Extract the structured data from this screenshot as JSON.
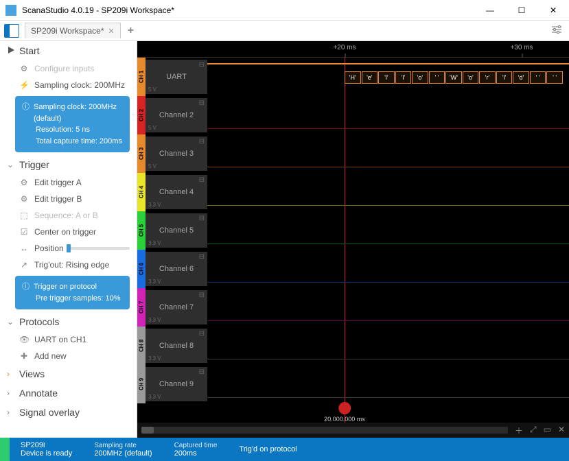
{
  "title": "ScanaStudio 4.0.19 - SP209i Workspace*",
  "tab": {
    "label": "SP209i Workspace*"
  },
  "sidebar": {
    "start": {
      "title": "Start",
      "configure_inputs": "Configure inputs",
      "sampling_item": "Sampling clock: 200MHz",
      "info": {
        "l1": "Sampling clock: 200MHz (default)",
        "l2": "Resolution: 5 ns",
        "l3": "Total capture time: 200ms"
      }
    },
    "trigger": {
      "title": "Trigger",
      "edit_a": "Edit trigger A",
      "edit_b": "Edit trigger B",
      "sequence": "Sequence: A or B",
      "center": "Center on trigger",
      "position": "Position",
      "trigout": "Trig'out: Rising edge",
      "info": {
        "l1": "Trigger on protocol",
        "l2": "Pre trigger samples: 10%"
      }
    },
    "protocols": {
      "title": "Protocols",
      "uart": "UART on CH1",
      "add": "Add new"
    },
    "views": "Views",
    "annotate": "Annotate",
    "signal_overlay": "Signal overlay"
  },
  "ruler": {
    "t20": "+20 ms",
    "t30": "+30 ms"
  },
  "channels": [
    {
      "tab": "CH 1",
      "name": "UART",
      "volt": "5 V",
      "color": "orange"
    },
    {
      "tab": "CH 2",
      "name": "Channel 2",
      "volt": "5 V",
      "color": "red"
    },
    {
      "tab": "CH 3",
      "name": "Channel 3",
      "volt": "5 V",
      "color": "orange2"
    },
    {
      "tab": "CH 4",
      "name": "Channel 4",
      "volt": "3.3 V",
      "color": "yellow"
    },
    {
      "tab": "CH 5",
      "name": "Channel 5",
      "volt": "3.3 V",
      "color": "green"
    },
    {
      "tab": "CH 6",
      "name": "Channel 6",
      "volt": "3.3 V",
      "color": "blue"
    },
    {
      "tab": "CH 7",
      "name": "Channel 7",
      "volt": "3.3 V",
      "color": "magenta"
    },
    {
      "tab": "CH 8",
      "name": "Channel 8",
      "volt": "3.3 V",
      "color": "gray"
    },
    {
      "tab": "CH 9",
      "name": "Channel 9",
      "volt": "3.3 V",
      "color": "gray2"
    }
  ],
  "uart_chars": [
    "'H'",
    "'e'",
    "'l'",
    "'l'",
    "'o'",
    "' '",
    "'W'",
    "'o'",
    "'r'",
    "'l'",
    "'d'",
    "' '",
    "' '"
  ],
  "marker_time": "20.000.000 ms",
  "status": {
    "device": "SP209i",
    "ready": "Device is ready",
    "rate_label": "Sampling rate",
    "rate": "200MHz (default)",
    "cap_label": "Captured time",
    "cap": "200ms",
    "trig": "Trig'd on protocol"
  }
}
